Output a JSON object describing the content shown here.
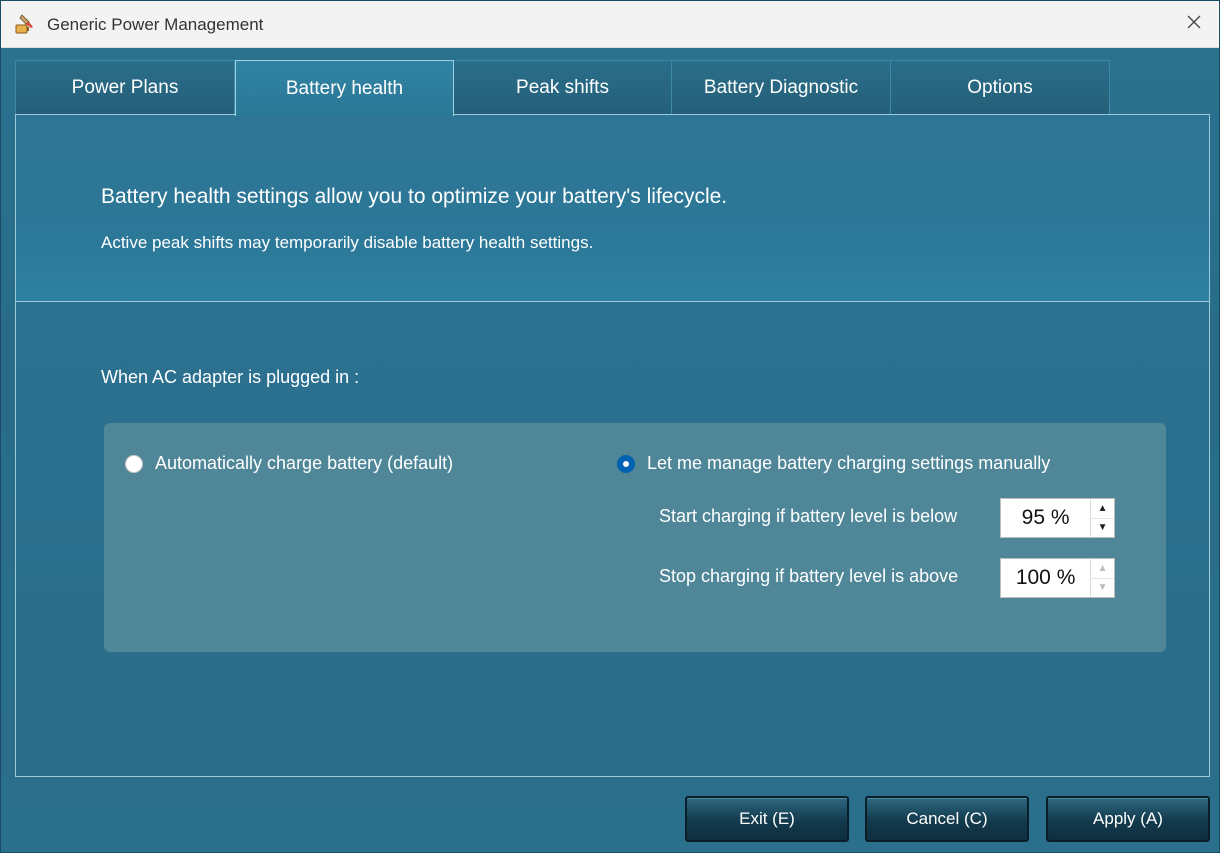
{
  "window": {
    "title": "Generic Power Management",
    "app_icon": "battery-brush-icon",
    "close_icon": "close-icon"
  },
  "tabs": [
    {
      "label": "Power Plans",
      "active": false
    },
    {
      "label": "Battery health",
      "active": true
    },
    {
      "label": "Peak shifts",
      "active": false
    },
    {
      "label": "Battery Diagnostic",
      "active": false
    },
    {
      "label": "Options",
      "active": false
    }
  ],
  "content": {
    "intro_line1": "Battery health settings allow you to optimize your battery's lifecycle.",
    "intro_line2": "Active peak shifts may temporarily disable battery health settings.",
    "ac_label": "When AC adapter is plugged in :",
    "option_auto": {
      "label": "Automatically charge battery (default)",
      "checked": false
    },
    "option_manual": {
      "label": "Let me manage battery charging settings manually",
      "checked": true
    },
    "start_charging": {
      "label": "Start charging if battery level is below",
      "value": "95 %"
    },
    "stop_charging": {
      "label": "Stop charging if battery level is above",
      "value": "100 %"
    }
  },
  "buttons": {
    "exit": "Exit (E)",
    "cancel": "Cancel (C)",
    "apply": "Apply (A)"
  },
  "colors": {
    "panel_blue": "#2b7190",
    "options_box": "#4f8799",
    "radio_selected": "#0063b1"
  }
}
